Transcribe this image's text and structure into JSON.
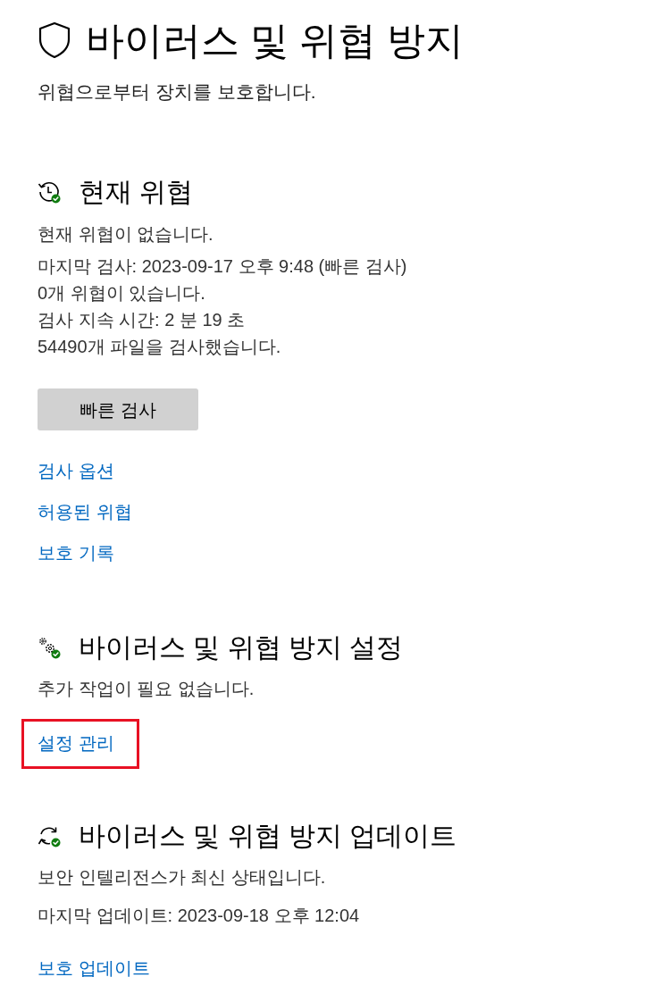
{
  "page": {
    "title": "바이러스 및 위협 방지",
    "subtitle": "위협으로부터 장치를 보호합니다."
  },
  "sections": [
    {
      "kind": "history",
      "heading": "현재 위협",
      "status": "현재 위협이 없습니다.",
      "details": [
        "마지막 검사: 2023-09-17 오후 9:48 (빠른 검사)",
        "0개 위협이 있습니다.",
        "검사 지속 시간: 2 분 19 초",
        "54490개 파일을 검사했습니다."
      ],
      "button": "빠른 검사",
      "links": [
        {
          "label": "검사 옵션",
          "highlighted": false
        },
        {
          "label": "허용된 위협",
          "highlighted": false
        },
        {
          "label": "보호 기록",
          "highlighted": false
        }
      ]
    },
    {
      "kind": "settings",
      "heading": "바이러스 및 위협 방지 설정",
      "status": "추가 작업이 필요 없습니다.",
      "links": [
        {
          "label": "설정 관리",
          "highlighted": true
        }
      ]
    },
    {
      "kind": "update",
      "heading": "바이러스 및 위협 방지 업데이트",
      "status": "보안 인텔리전스가 최신 상태입니다.",
      "details": [
        "마지막 업데이트: 2023-09-18 오후 12:04"
      ],
      "links": [
        {
          "label": "보호 업데이트",
          "highlighted": false
        }
      ]
    }
  ]
}
